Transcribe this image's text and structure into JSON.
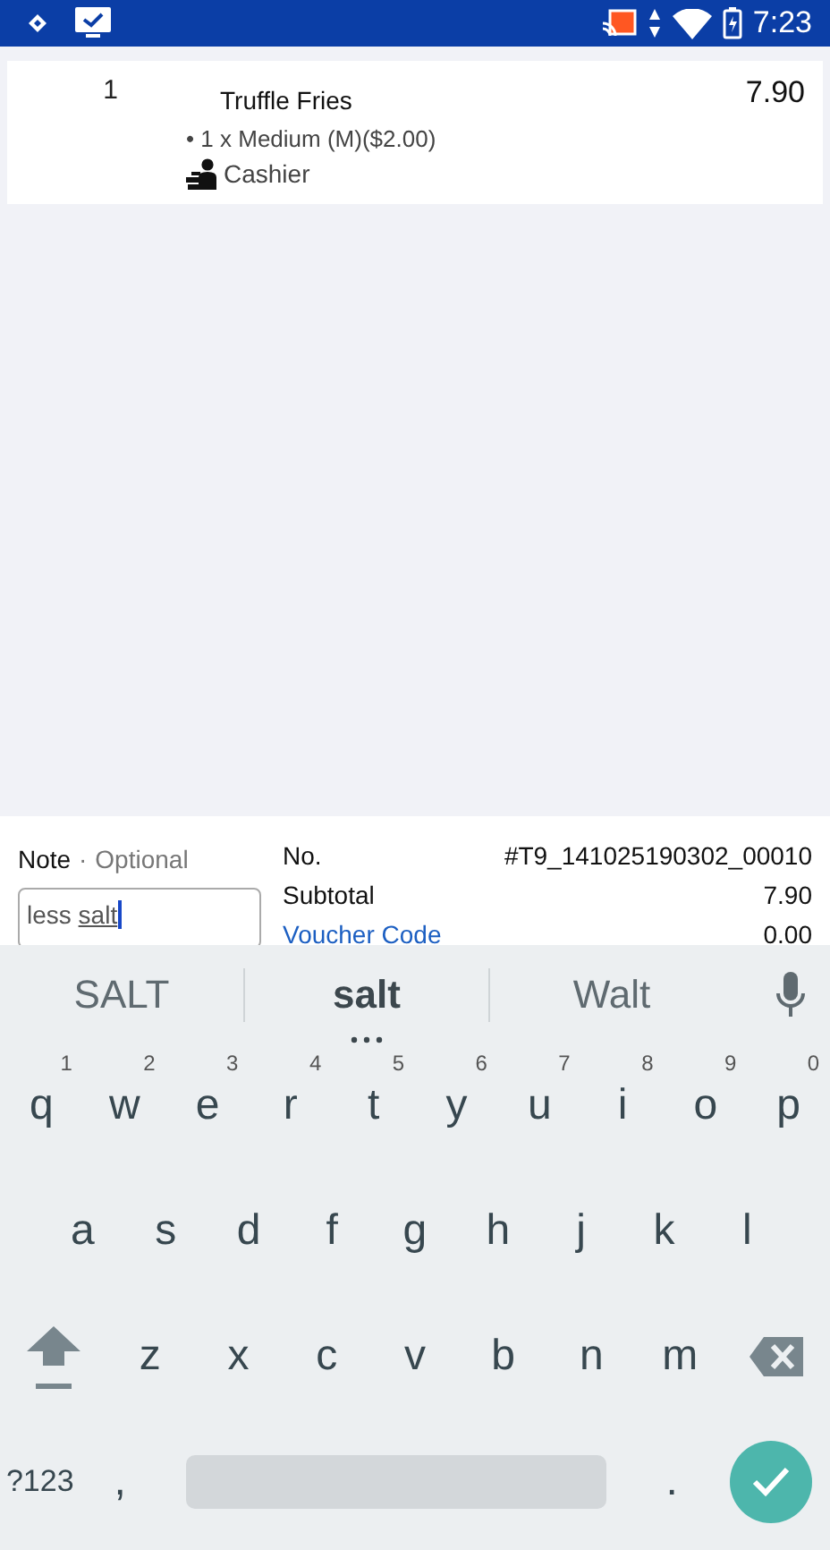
{
  "status_bar": {
    "time": "7:23"
  },
  "order_items": [
    {
      "quantity": "1",
      "name": "Truffle Fries",
      "price": "7.90",
      "modifiers": [
        "• 1 x Medium (M)($2.00)"
      ],
      "staff": "Cashier"
    }
  ],
  "note": {
    "label": "Note",
    "separator": "·",
    "hint": "Optional",
    "value_parts": [
      {
        "text": "less ",
        "underlined": false
      },
      {
        "text": "salt",
        "underlined": true
      }
    ]
  },
  "summary": [
    {
      "label": "No.",
      "value": "#T9_141025190302_00010",
      "kind": "plain"
    },
    {
      "label": "Subtotal",
      "value": "7.90",
      "kind": "plain"
    },
    {
      "label": "Voucher Code",
      "value": "0.00",
      "kind": "link"
    }
  ],
  "keyboard": {
    "suggestions": [
      {
        "text": "SALT",
        "selected": false
      },
      {
        "text": "salt",
        "selected": true
      },
      {
        "text": "Walt",
        "selected": false
      }
    ],
    "rows": [
      {
        "keys": [
          {
            "kind": "letter",
            "label": "q",
            "hint": "1"
          },
          {
            "kind": "letter",
            "label": "w",
            "hint": "2"
          },
          {
            "kind": "letter",
            "label": "e",
            "hint": "3"
          },
          {
            "kind": "letter",
            "label": "r",
            "hint": "4"
          },
          {
            "kind": "letter",
            "label": "t",
            "hint": "5"
          },
          {
            "kind": "letter",
            "label": "y",
            "hint": "6"
          },
          {
            "kind": "letter",
            "label": "u",
            "hint": "7"
          },
          {
            "kind": "letter",
            "label": "i",
            "hint": "8"
          },
          {
            "kind": "letter",
            "label": "o",
            "hint": "9"
          },
          {
            "kind": "letter",
            "label": "p",
            "hint": "0"
          }
        ]
      },
      {
        "keys": [
          {
            "kind": "letter",
            "label": "a"
          },
          {
            "kind": "letter",
            "label": "s"
          },
          {
            "kind": "letter",
            "label": "d"
          },
          {
            "kind": "letter",
            "label": "f"
          },
          {
            "kind": "letter",
            "label": "g"
          },
          {
            "kind": "letter",
            "label": "h"
          },
          {
            "kind": "letter",
            "label": "j"
          },
          {
            "kind": "letter",
            "label": "k"
          },
          {
            "kind": "letter",
            "label": "l"
          }
        ]
      },
      {
        "keys": [
          {
            "kind": "shift"
          },
          {
            "kind": "letter",
            "label": "z"
          },
          {
            "kind": "letter",
            "label": "x"
          },
          {
            "kind": "letter",
            "label": "c"
          },
          {
            "kind": "letter",
            "label": "v"
          },
          {
            "kind": "letter",
            "label": "b"
          },
          {
            "kind": "letter",
            "label": "n"
          },
          {
            "kind": "letter",
            "label": "m"
          },
          {
            "kind": "backspace"
          }
        ]
      },
      {
        "keys": [
          {
            "kind": "symbols",
            "label": "?123"
          },
          {
            "kind": "letter",
            "label": ","
          },
          {
            "kind": "space"
          },
          {
            "kind": "letter",
            "label": "."
          },
          {
            "kind": "enter"
          }
        ]
      }
    ]
  }
}
